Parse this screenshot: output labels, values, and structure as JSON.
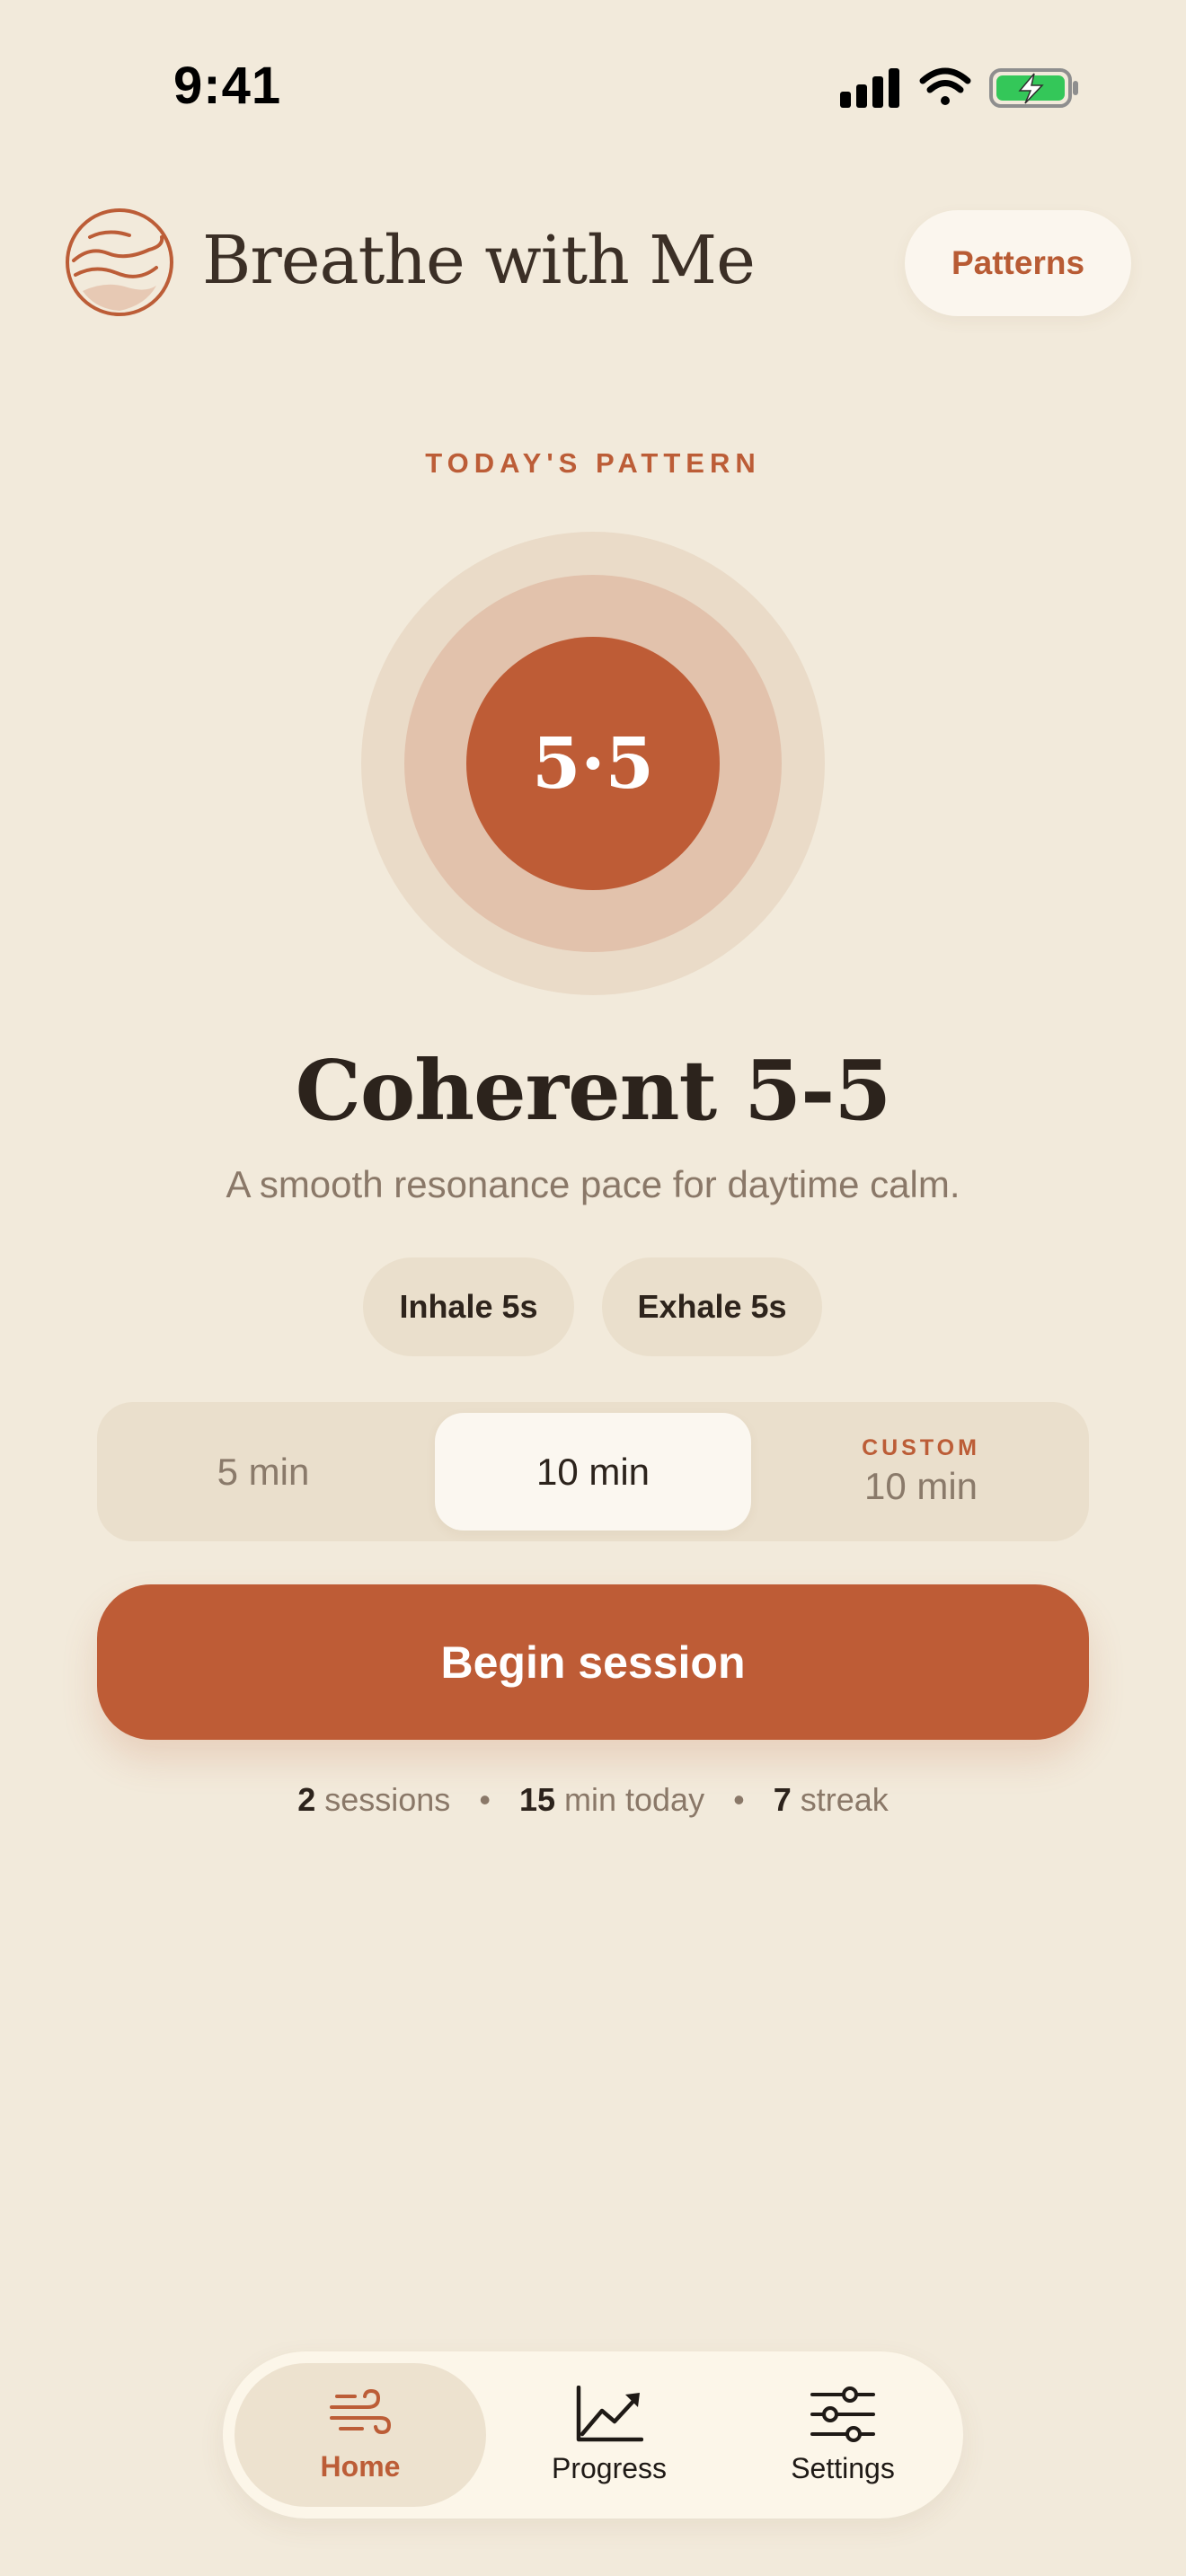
{
  "status_bar": {
    "time": "9:41"
  },
  "header": {
    "app_title": "Breathe with Me",
    "patterns_button": "Patterns"
  },
  "pattern": {
    "eyebrow": "TODAY'S PATTERN",
    "core_label": "5·5",
    "title": "Coherent 5-5",
    "subtitle": "A smooth resonance pace for daytime calm.",
    "chips": [
      "Inhale 5s",
      "Exhale 5s"
    ]
  },
  "duration": {
    "options": [
      "5 min",
      "10 min"
    ],
    "selected": "10 min",
    "custom_label": "CUSTOM",
    "custom_value": "10 min"
  },
  "begin_button": "Begin session",
  "stats": {
    "sessions_count": "2",
    "sessions_label": "sessions",
    "minutes_count": "15",
    "minutes_label": "min today",
    "streak_count": "7",
    "streak_label": "streak",
    "separator": "•"
  },
  "tabs": [
    {
      "label": "Home",
      "icon": "wind-icon",
      "active": true
    },
    {
      "label": "Progress",
      "icon": "chart-up-icon",
      "active": false
    },
    {
      "label": "Settings",
      "icon": "sliders-icon",
      "active": false
    }
  ],
  "colors": {
    "background": "#F2EADB",
    "accent": "#BE5C36",
    "text": "#2E241C",
    "muted": "#8A7868",
    "surface": "#FBF6EE"
  }
}
